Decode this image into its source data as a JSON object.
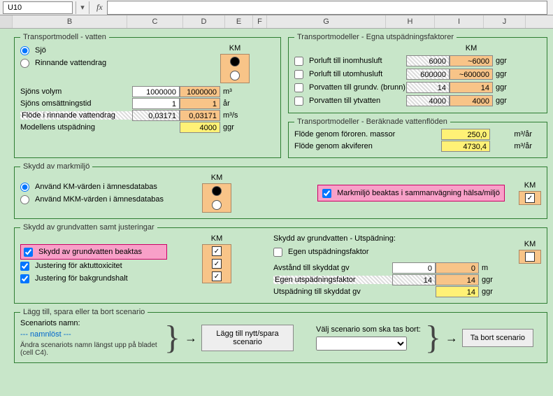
{
  "formula_bar": {
    "cell_ref": "U10",
    "fx_label": "fx"
  },
  "cols": {
    "B": "B",
    "C": "C",
    "D": "D",
    "E": "E",
    "F": "F",
    "G": "G",
    "H": "H",
    "I": "I",
    "J": "J"
  },
  "km_label": "KM",
  "fs1": {
    "legend": "Transportmodell - vatten",
    "opt_sjo": "Sjö",
    "opt_rinn": "Rinnande vattendrag",
    "rows": [
      {
        "label": "Sjöns volym",
        "c": "1000000",
        "d": "1000000",
        "u": "m³"
      },
      {
        "label": "Sjöns omsättningstid",
        "c": "1",
        "d": "1",
        "u": "år"
      },
      {
        "label": "Flöde i rinnande vattendrag",
        "c": "0,03171",
        "d": "0,03171",
        "u": "m³/s"
      },
      {
        "label": "Modellens utspädning",
        "c": "",
        "d": "4000",
        "u": "ggr"
      }
    ]
  },
  "fs2": {
    "legend": "Transportmodeller - Egna utspädningsfaktorer",
    "rows": [
      {
        "label": "Porluft till inomhusluft",
        "h": "6000",
        "i": "~6000",
        "u": "ggr"
      },
      {
        "label": "Porluft till utomhusluft",
        "h": "600000",
        "i": "~600000",
        "u": "ggr"
      },
      {
        "label": "Porvatten till grundv. (brunn)",
        "h": "14",
        "i": "14",
        "u": "ggr"
      },
      {
        "label": "Porvatten till ytvatten",
        "h": "4000",
        "i": "4000",
        "u": "ggr"
      }
    ]
  },
  "fs3": {
    "legend": "Transportmodeller - Beräknade vattenflöden",
    "rows": [
      {
        "label": "Flöde genom föroren. massor",
        "v": "250,0",
        "u": "m³/år"
      },
      {
        "label": "Flöde genom akviferen",
        "v": "4730,4",
        "u": "m³/år"
      }
    ]
  },
  "fs4": {
    "legend": "Skydd av markmiljö",
    "opt_km": "Använd KM-värden i ämnesdatabas",
    "opt_mkm": "Använd MKM-värden i ämnesdatabas",
    "chk_label": "Markmiljö beaktas i sammanvägning hälsa/miljö"
  },
  "fs5": {
    "legend": "Skydd av grundvatten samt justeringar",
    "chk1": "Skydd av grundvatten beaktas",
    "chk2": "Justering för aktuttoxicitet",
    "chk3": "Justering för bakgrundshalt",
    "right_title": "Skydd av grundvatten - Utspädning:",
    "chk_egen": "Egen utspädningsfaktor",
    "rows": [
      {
        "label": "Avstånd till skyddat gv",
        "h": "0",
        "i": "0",
        "u": "m"
      },
      {
        "label": "Egen utspädningsfaktor",
        "h": "14",
        "i": "14",
        "u": "ggr"
      },
      {
        "label": "Utspädning till skyddat gv",
        "h": "",
        "i": "14",
        "u": "ggr"
      }
    ]
  },
  "fs6": {
    "legend": "Lägg till, spara eller ta bort scenario",
    "name_label": "Scenariots namn:",
    "name_val": "--- namnlöst ---",
    "note": "Ändra scenariots namn längst upp på bladet (cell C4).",
    "btn_add": "Lägg till nytt/spara scenario",
    "sel_label": "Välj scenario som ska tas bort:",
    "btn_del": "Ta bort scenario"
  }
}
